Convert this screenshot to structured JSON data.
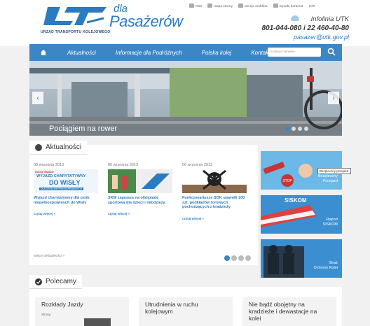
{
  "header": {
    "logo_dla": "dla",
    "logo_pasazerow": "Pasażerów",
    "logo_tagline": "URZĄD TRANSPORTU KOLEJOWEGO",
    "utility": [
      "RSS",
      "mapa strony",
      "wersja mobilna",
      "wysoki kontrast",
      "UTK"
    ],
    "infolinia": "Infolinia UTK",
    "phones": "801-044-080 i 22 460-40-80",
    "email": "pasazer@utk.gov.pl"
  },
  "nav": {
    "items": [
      "Aktualności",
      "Informacje dla Podróżnych",
      "Polska kolej",
      "Kontakt"
    ],
    "search_placeholder": "szukaj w serwisie"
  },
  "hero": {
    "caption": "Pociągiem na rower",
    "slides": 4,
    "active_slide": 1
  },
  "news": {
    "section_title": "Aktualności",
    "items": [
      {
        "date": "09 września 2013",
        "title": "Wyjazd charytatywny dla osób niepełnosprawnych do Wisły",
        "more": "czytaj więcej »",
        "thumb_brand": "Koleje Śląskie",
        "thumb_line1": "WYJAZD CHARYTATYWNY",
        "thumb_line2": "DO WISŁY",
        "thumb_line3": "DLA OSÓB NIEPEŁNOSPRAWNYCH"
      },
      {
        "date": "06 września 2013",
        "title": "SKM zaprasza na olimpiadę sportową dla dzieci i młodzieży.",
        "more": "czytaj więcej »"
      },
      {
        "date": "06 września 2013",
        "title": "Funkcjonariusze SOK ujawnili 100 szt. podkładów torowych pochodzących z kradzieży",
        "more": "czytaj więcej »"
      }
    ],
    "all_news": "więcej aktualności »",
    "pages": 4,
    "active_page": 1
  },
  "banners": [
    {
      "label_line1": "Bezpieczny",
      "label_line2": "Przejazd"
    },
    {
      "label_line1": "Raport",
      "label_line2": "SISKOM",
      "logo": "SISKOM"
    },
    {
      "label_line1": "Straż",
      "label_line2": "Ochrony Kolei"
    }
  ],
  "banner_sign": "STOP",
  "tooltip": "Bezpieczny przejazd",
  "recommended": {
    "section_title": "Polecamy",
    "items": [
      {
        "title": "Rozkłady Jazdy",
        "sub": "Strony"
      },
      {
        "title": "Utrudnienia w ruchu kolejowym",
        "sub": ""
      },
      {
        "title": "Nie bądź obojętny na kradzieże i dewastacje na kolei",
        "sub": ""
      }
    ]
  },
  "colors": {
    "accent": "#3d86c6",
    "brand": "#2b7bc0",
    "background": "#f1f1f1"
  }
}
